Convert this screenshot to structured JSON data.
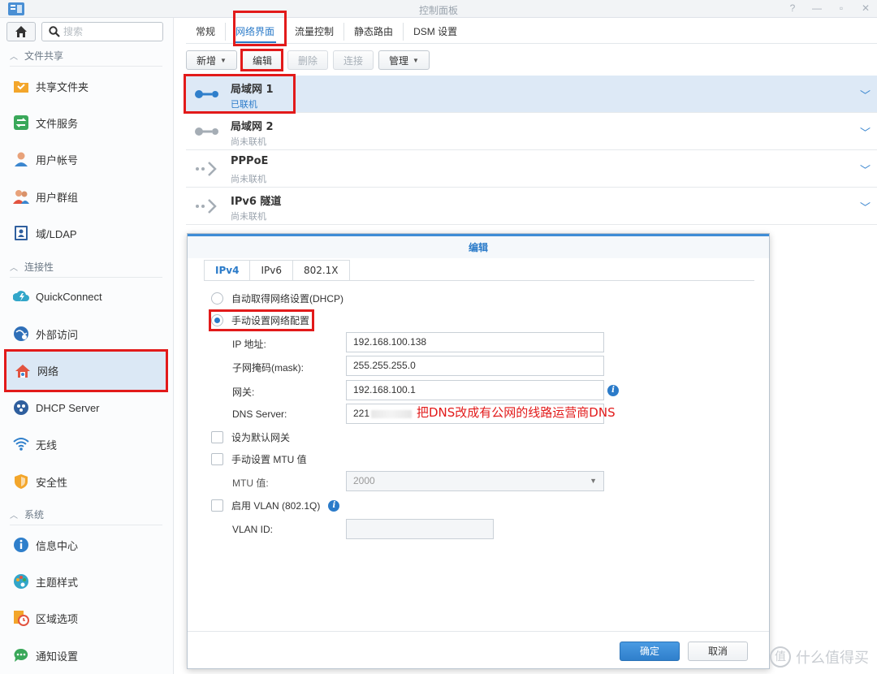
{
  "window": {
    "title": "控制面板",
    "controls": [
      "?",
      "—",
      "▫",
      "✕"
    ]
  },
  "sidebar": {
    "search_placeholder": "搜索",
    "sections": [
      {
        "label": "文件共享"
      },
      {
        "label": "连接性"
      },
      {
        "label": "系统"
      }
    ],
    "items": [
      {
        "label": "共享文件夹",
        "icon": "shared-folder-icon"
      },
      {
        "label": "文件服务",
        "icon": "file-services-icon"
      },
      {
        "label": "用户帐号",
        "icon": "user-icon"
      },
      {
        "label": "用户群组",
        "icon": "group-icon"
      },
      {
        "label": "域/LDAP",
        "icon": "domain-ldap-icon"
      },
      {
        "label": "QuickConnect",
        "icon": "quickconnect-icon"
      },
      {
        "label": "外部访问",
        "icon": "external-access-icon"
      },
      {
        "label": "网络",
        "icon": "network-icon"
      },
      {
        "label": "DHCP Server",
        "icon": "dhcp-server-icon"
      },
      {
        "label": "无线",
        "icon": "wireless-icon"
      },
      {
        "label": "安全性",
        "icon": "security-shield-icon"
      },
      {
        "label": "信息中心",
        "icon": "info-center-icon"
      },
      {
        "label": "主题样式",
        "icon": "theme-palette-icon"
      },
      {
        "label": "区域选项",
        "icon": "regional-options-icon"
      },
      {
        "label": "通知设置",
        "icon": "notification-icon"
      }
    ]
  },
  "tabs": [
    "常规",
    "网络界面",
    "流量控制",
    "静态路由",
    "DSM 设置"
  ],
  "toolbar": {
    "create": "新增",
    "edit": "编辑",
    "delete": "删除",
    "connect": "连接",
    "manage": "管理"
  },
  "interfaces": [
    {
      "name": "局域网 1",
      "status": "已联机"
    },
    {
      "name": "局域网 2",
      "status": "尚未联机"
    },
    {
      "name": "PPPoE",
      "status": "尚未联机"
    },
    {
      "name": "IPv6 隧道",
      "status": "尚未联机"
    }
  ],
  "dialog": {
    "title": "编辑",
    "tabs": [
      "IPv4",
      "IPv6",
      "802.1X"
    ],
    "dhcp_option": "自动取得网络设置(DHCP)",
    "manual_option": "手动设置网络配置",
    "fields": {
      "ip_label": "IP 地址:",
      "ip_value": "192.168.100.138",
      "mask_label": "子网掩码(mask):",
      "mask_value": "255.255.255.0",
      "gateway_label": "网关:",
      "gateway_value": "192.168.100.1",
      "dns_label": "DNS Server:",
      "dns_value": "221"
    },
    "annotation": "把DNS改成有公网的线路运营商DNS",
    "default_gateway": "设为默认网关",
    "manual_mtu": "手动设置 MTU 值",
    "mtu_label": "MTU 值:",
    "mtu_value": "2000",
    "vlan_option": "启用 VLAN (802.1Q)",
    "vlan_id_label": "VLAN ID:",
    "ok": "确定",
    "cancel": "取消"
  },
  "watermark": "什么值得买",
  "colors": {
    "accent": "#2b7bc9",
    "highlight": "#e21a1a",
    "selected_row": "#dde9f6"
  }
}
